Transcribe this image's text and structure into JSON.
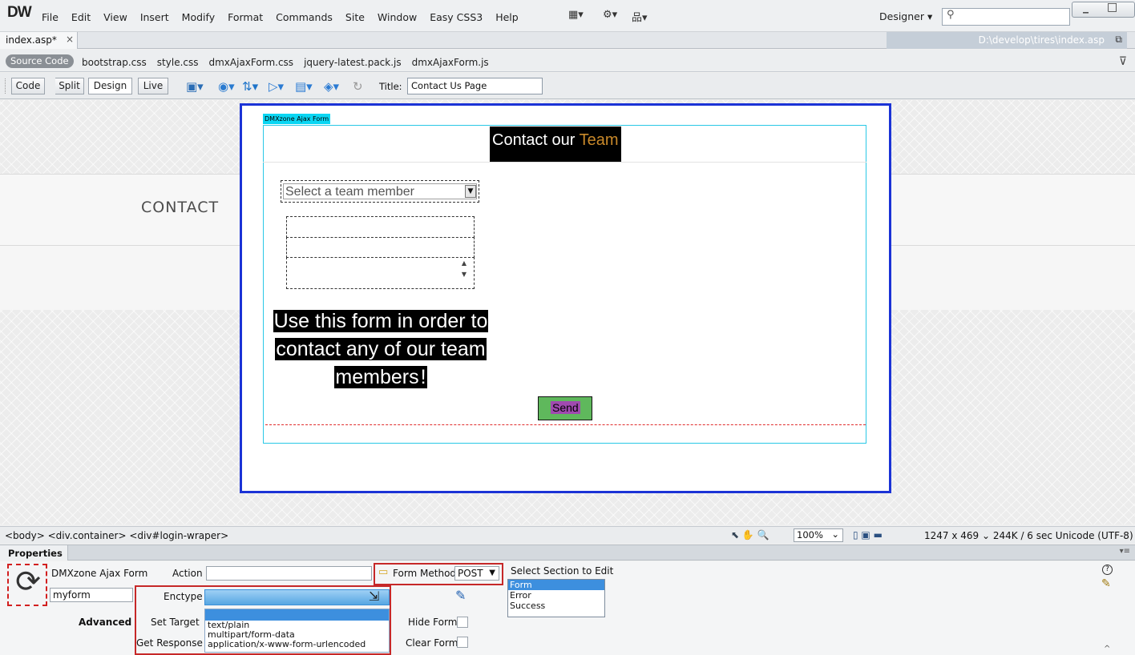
{
  "app": {
    "logo": "DW",
    "menu": [
      "File",
      "Edit",
      "View",
      "Insert",
      "Modify",
      "Format",
      "Commands",
      "Site",
      "Window",
      "Easy CSS3",
      "Help"
    ],
    "workspace": "Designer",
    "workspace_arrow": "▾",
    "search_icon": "⚲",
    "layout_icon": "▦▾",
    "gear_icon": "⚙▾",
    "sitemap_icon": "品▾",
    "min_icon": "_",
    "max_icon": "□"
  },
  "tabs": {
    "active": "index.asp*",
    "close": "×",
    "path": "D:\\develop\\tires\\index.asp",
    "restore_icon": "⧉"
  },
  "related": {
    "source": "Source Code",
    "files": [
      "bootstrap.css",
      "style.css",
      "dmxAjaxForm.css",
      "jquery-latest.pack.js",
      "dmxAjaxForm.js"
    ],
    "filter_icon": "⊽"
  },
  "docbar": {
    "views": [
      "Code",
      "Split",
      "Design",
      "Live"
    ],
    "title_label": "Title:",
    "title_value": "Contact Us Page",
    "icons": [
      "file-manage-icon",
      "browser-icon",
      "validate-icon",
      "check-icon",
      "visual-aids-icon",
      "live-view-icon",
      "refresh-icon"
    ]
  },
  "canvas": {
    "contact": "CONTACT",
    "form_tag": "DMXzone Ajax Form",
    "heading_a": "Contact our ",
    "heading_b": "Team",
    "select_placeholder": "Select a team member",
    "select_arrow": "▼",
    "intro_line1": "Use this form in order to",
    "intro_line2": "contact any of our team",
    "intro_line3a": "members",
    "intro_line3b": "!",
    "send": "Send",
    "scroll_up": "▲",
    "scroll_down": "▼"
  },
  "status": {
    "tagpath": "<body> <div.container> <div#login-wraper>",
    "zoom": "100%",
    "zoom_arrow": "⌄",
    "info": "1247 x 469 ⌄  244K / 6 sec  Unicode (UTF-8)",
    "tool_icons": "⬉ ✋ 🔍"
  },
  "properties": {
    "panel_title": "Properties",
    "component": "DMXzone Ajax Form",
    "form_name": "myform",
    "action_label": "Action",
    "action_value": "",
    "enctype_label": "Enctype",
    "enctype_options": [
      "",
      "text/plain",
      "multipart/form-data",
      "application/x-www-form-urlencoded"
    ],
    "form_method_label": "Form Method",
    "form_method_value": "POST",
    "method_arrow": "▼",
    "advanced_label": "Advanced",
    "set_target_label": "Set Target",
    "get_response_label": "Get Response",
    "hide_form_label": "Hide Form",
    "clear_form_label": "Clear Form",
    "section_label": "Select Section to Edit",
    "sections": [
      "Form",
      "Error",
      "Success"
    ],
    "help_icon": "?",
    "edit_icon": "✎",
    "cursor": "⇲",
    "refresh_glyph": "⟳"
  }
}
